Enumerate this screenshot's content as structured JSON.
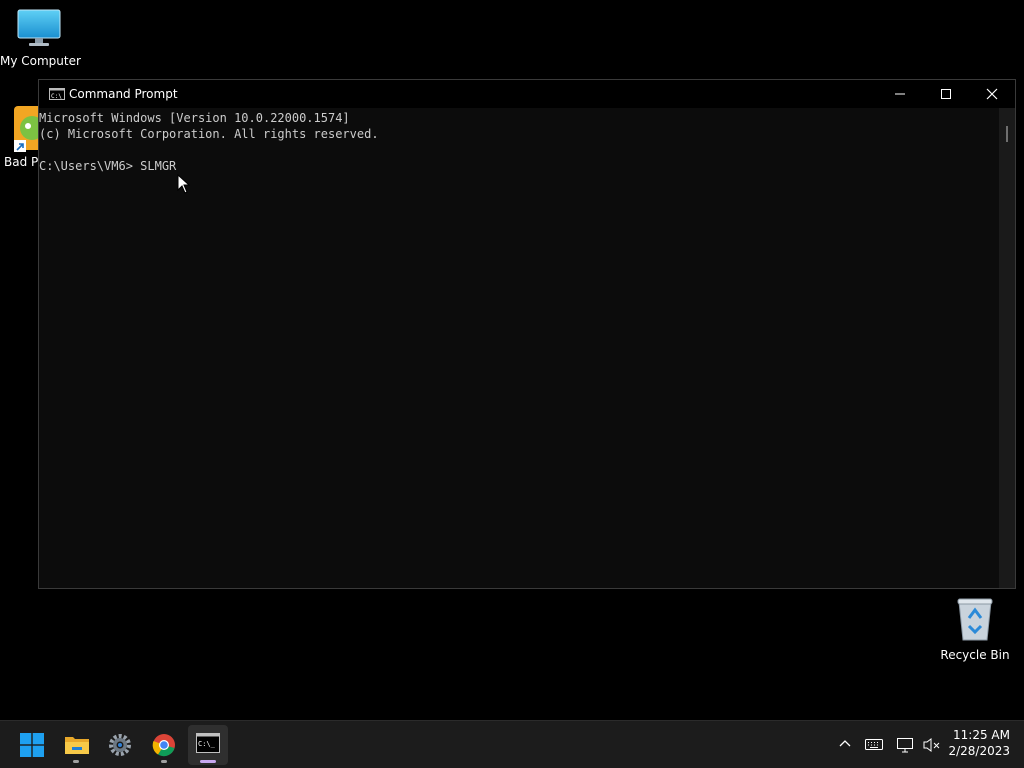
{
  "desktop": {
    "icons": [
      {
        "label": "My Computer"
      },
      {
        "label": "Bad P"
      },
      {
        "label": "Recycle Bin"
      }
    ]
  },
  "window": {
    "title": "Command Prompt",
    "console_lines": [
      "Microsoft Windows [Version 10.0.22000.1574]",
      "(c) Microsoft Corporation. All rights reserved.",
      "",
      "C:\\Users\\VM6> SLMGR"
    ]
  },
  "taskbar": {
    "items": [
      {
        "icon": "windows-start-icon"
      },
      {
        "icon": "file-explorer-icon"
      },
      {
        "icon": "settings-gear-icon"
      },
      {
        "icon": "chrome-icon"
      },
      {
        "icon": "command-prompt-icon",
        "active": true
      }
    ],
    "clock": {
      "time": "11:25 AM",
      "date": "2/28/2023"
    }
  },
  "colors": {
    "console_text": "#cccccc",
    "console_bg": "#0c0c0c",
    "taskbar_bg": "#1c1c1c",
    "active_indicator": "#c8a8f0"
  }
}
